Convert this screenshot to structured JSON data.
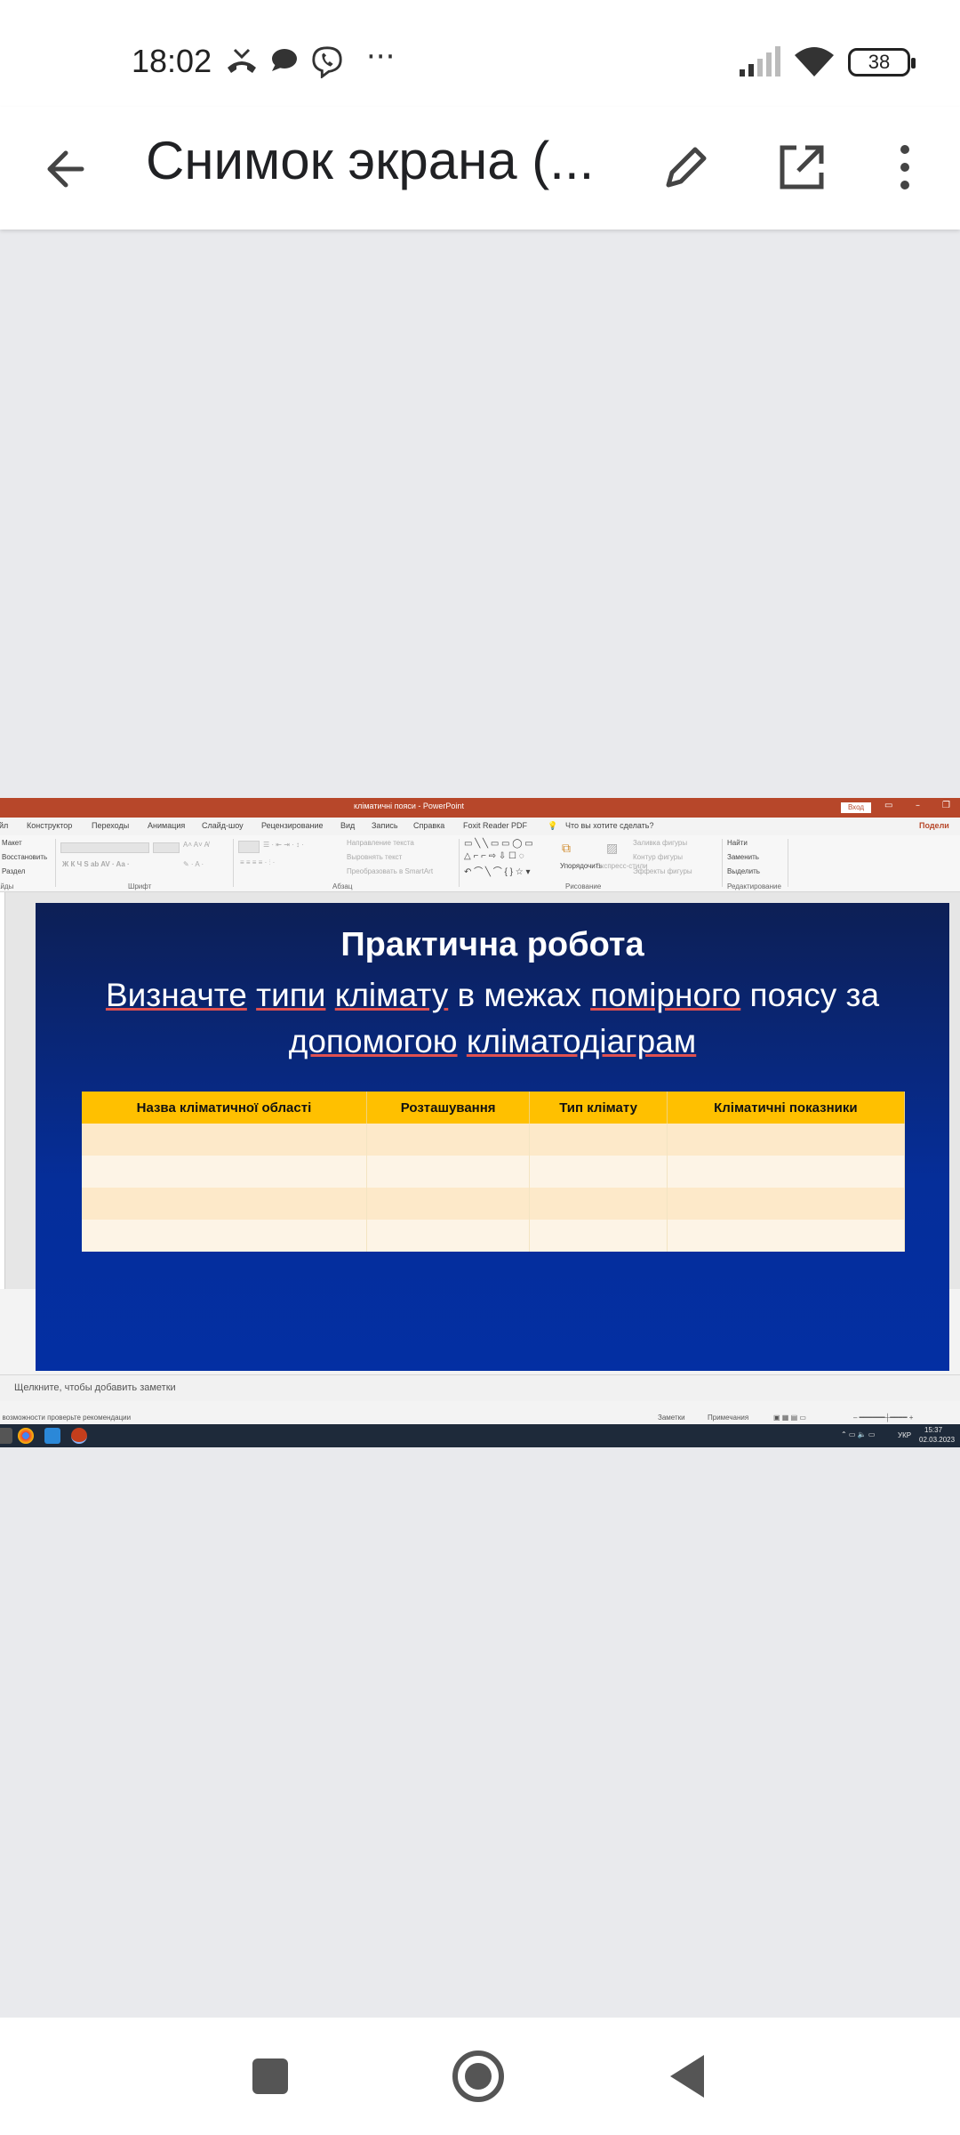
{
  "status_bar": {
    "time": "18:02",
    "battery": "38",
    "icons": [
      "missed-call-icon",
      "chat-bubble-icon",
      "viber-icon",
      "more-dots-icon",
      "signal-icon",
      "wifi-icon",
      "battery-icon"
    ],
    "more": "···"
  },
  "app_bar": {
    "title": "Снимок экрана (...",
    "icons": [
      "back-arrow-icon",
      "pencil-edit-icon",
      "open-external-icon",
      "more-vert-icon"
    ]
  },
  "powerpoint": {
    "window_title": "кліматичні пояси  -  PowerPoint",
    "sign_in": "Вход",
    "share": "Подели",
    "tabs": [
      "айл",
      "Конструктор",
      "Переходы",
      "Анимация",
      "Слайд-шоу",
      "Рецензирование",
      "Вид",
      "Запись",
      "Справка",
      "Foxit Reader PDF",
      "Что вы хотите сделать?"
    ],
    "ribbon": {
      "layout": "Макет",
      "reset": "Восстановить",
      "section": "Раздел",
      "text_direction": "Направление текста",
      "align_text": "Выровнять текст",
      "convert_smartart": "Преобразовать в SmartArt",
      "arrange": "Упорядочить",
      "quick_styles": "Экспресс-стили",
      "shape_fill": "Заливка фигуры",
      "shape_outline": "Контур фигуры",
      "shape_effects": "Эффекты фигуры",
      "find": "Найти",
      "replace": "Заменить",
      "select": "Выделить",
      "groups": [
        "айды",
        "Шрифт",
        "Абзац",
        "Рисование",
        "Редактирование"
      ]
    },
    "slide": {
      "title": "Практична робота",
      "subtitle_words": [
        {
          "t": "Визначте",
          "u": true
        },
        {
          "t": " ",
          "u": false
        },
        {
          "t": "типи",
          "u": true
        },
        {
          "t": " ",
          "u": false
        },
        {
          "t": "клімату",
          "u": true
        },
        {
          "t": " в межах ",
          "u": false
        },
        {
          "t": "помірного",
          "u": true
        },
        {
          "t": " поясу за ",
          "u": false
        },
        {
          "t": "допомогою",
          "u": true
        },
        {
          "t": " ",
          "u": false
        },
        {
          "t": "кліматодіаграм",
          "u": true
        }
      ],
      "table": {
        "headers": [
          "Назва кліматичної області",
          "Розташування",
          "Тип клімату",
          "Кліматичні показники"
        ],
        "rows": [
          [
            "",
            "",
            "",
            ""
          ],
          [
            "",
            "",
            "",
            ""
          ],
          [
            "",
            "",
            "",
            ""
          ],
          [
            "",
            "",
            "",
            ""
          ]
        ]
      }
    },
    "notes_placeholder": "Щелкните, чтобы добавить заметки",
    "status": {
      "accessibility": ": возможности проверьте рекомендации",
      "notes": "Заметки",
      "comments": "Примечания"
    },
    "taskbar": {
      "lang": "УКР",
      "clock_time": "15:37",
      "clock_date": "02.03.2023"
    }
  },
  "nav_bar": {
    "icons": [
      "recents-square-icon",
      "home-circle-icon",
      "back-triangle-icon"
    ]
  }
}
